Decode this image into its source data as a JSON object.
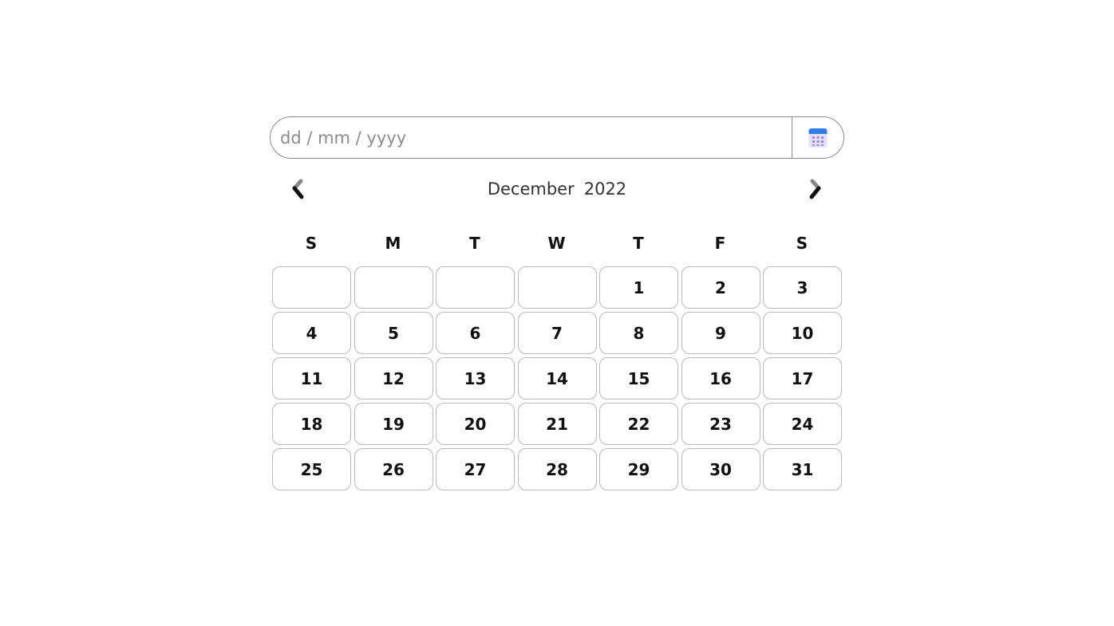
{
  "input": {
    "placeholder": "dd / mm / yyyy",
    "value": ""
  },
  "calendar_button": {
    "icon": "calendar-icon"
  },
  "header": {
    "month": "December",
    "year": "2022",
    "prev_icon": "chevron-left-icon",
    "next_icon": "chevron-right-icon"
  },
  "weekdays": [
    "S",
    "M",
    "T",
    "W",
    "T",
    "F",
    "S"
  ],
  "weeks": [
    [
      "",
      "",
      "",
      "",
      "1",
      "2",
      "3"
    ],
    [
      "4",
      "5",
      "6",
      "7",
      "8",
      "9",
      "10"
    ],
    [
      "11",
      "12",
      "13",
      "14",
      "15",
      "16",
      "17"
    ],
    [
      "18",
      "19",
      "20",
      "21",
      "22",
      "23",
      "24"
    ],
    [
      "25",
      "26",
      "27",
      "28",
      "29",
      "30",
      "31"
    ]
  ],
  "colors": {
    "border": "#8a8a8a",
    "cell_border": "#b9b9b9",
    "icon_blue": "#2f80ed",
    "icon_lavender": "#e6dcf7"
  }
}
